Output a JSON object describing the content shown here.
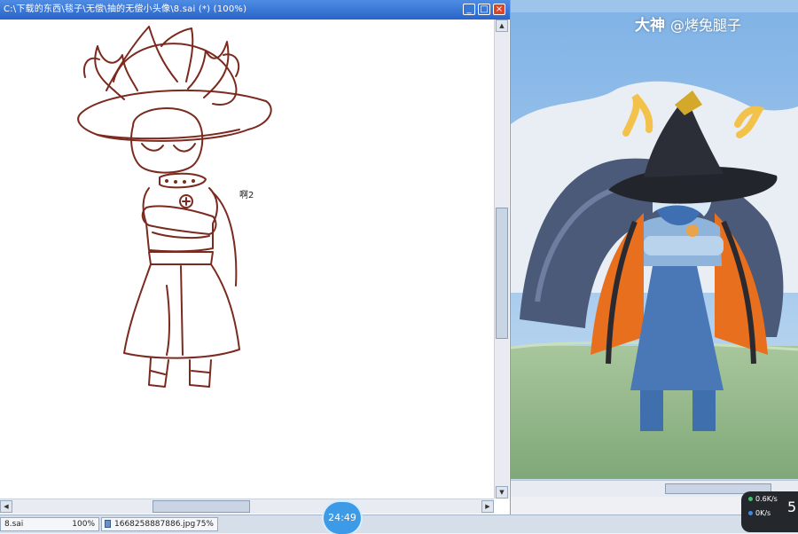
{
  "left_window": {
    "title": "C:\\下载的东西\\毯子\\无偿\\抽的无偿小头像\\8.sai  (*)  (100%)",
    "buttons": {
      "minimize": "_",
      "maximize": "□",
      "close": "×"
    }
  },
  "canvas": {
    "cursor_label": "啊2"
  },
  "right_window": {
    "watermark_brand": "大神",
    "watermark_user": "@烤兔腿子"
  },
  "taskbar": {
    "tabs": [
      {
        "name": "8.sai",
        "zoom": "100%"
      },
      {
        "name": "1668258887886.jpg",
        "zoom": "75%"
      }
    ]
  },
  "timer": "24:49",
  "network": {
    "upload": "0.6K/s",
    "download": "0K/s",
    "badge": "5",
    "upload_color": "#3cc46a",
    "download_color": "#3c8ae6"
  },
  "colors": {
    "line_art": "#7a2a1e",
    "titlebar": "#2a64c8"
  }
}
